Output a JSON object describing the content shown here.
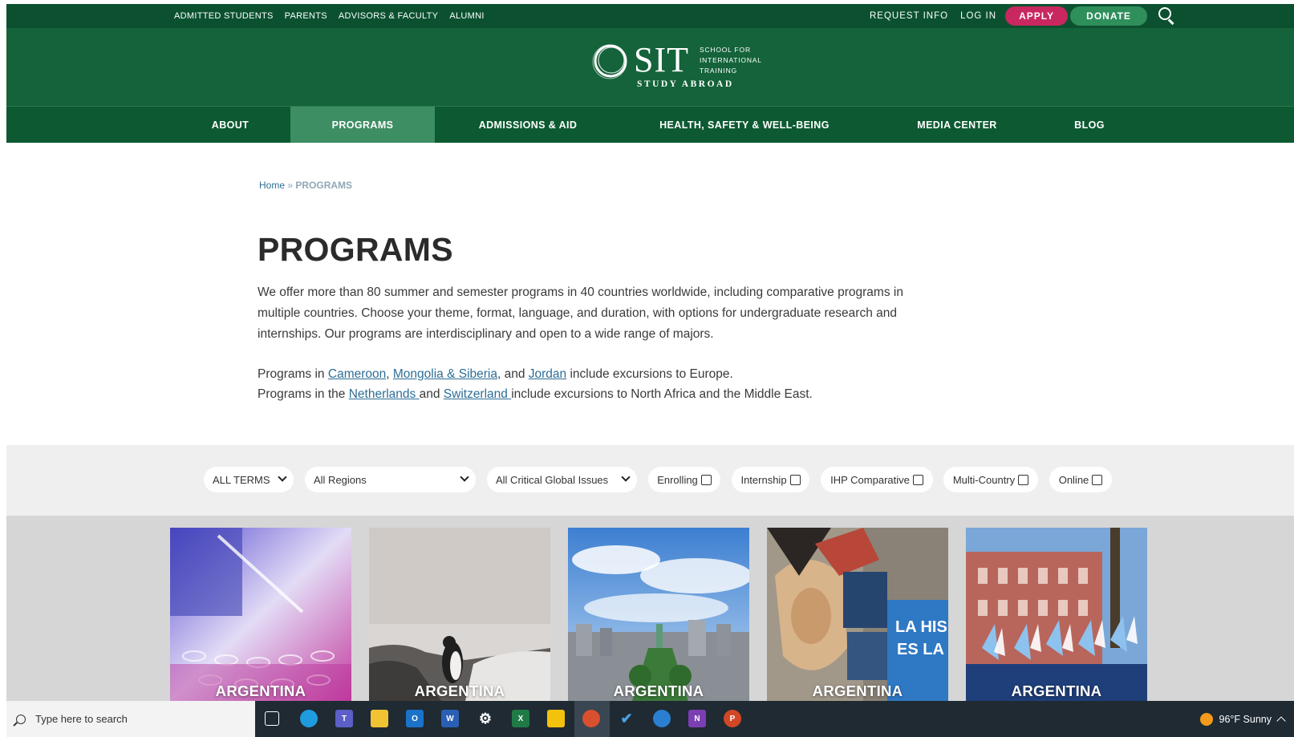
{
  "utility_nav": {
    "left_links": [
      "ADMITTED STUDENTS",
      "PARENTS",
      "ADVISORS & FACULTY",
      "ALUMNI"
    ],
    "request_info": "REQUEST INFO",
    "log_in": "LOG IN",
    "apply": "APPLY",
    "donate": "DONATE"
  },
  "logo": {
    "sit": "SIT",
    "school_line1": "SCHOOL FOR",
    "school_line2": "INTERNATIONAL",
    "school_line3": "TRAINING",
    "study_abroad": "STUDY ABROAD"
  },
  "main_nav": [
    "ABOUT",
    "PROGRAMS",
    "ADMISSIONS & AID",
    "HEALTH, SAFETY & WELL-BEING",
    "MEDIA CENTER",
    "BLOG"
  ],
  "breadcrumb": {
    "home": "Home",
    "sep": "»",
    "current": "PROGRAMS"
  },
  "page_title": "PROGRAMS",
  "intro": "We offer more than 80 summer and semester programs in 40 countries worldwide, including comparative programs in multiple countries. Choose your theme, format, language, and duration, with options for undergraduate research and internships. Our programs are interdisciplinary and open to a wide range of majors.",
  "excursions_europe": {
    "prefix": "Programs in ",
    "link1": "Cameroon",
    "comma": ", ",
    "link2": "Mongolia & Siberia",
    "and": ", and ",
    "link3": "Jordan",
    "suffix": " include excursions to Europe."
  },
  "excursions_africa": {
    "prefix": "Programs in the ",
    "link1": "Netherlands ",
    "and": "and ",
    "link2": "Switzerland ",
    "suffix": "include excursions to North Africa and the Middle East."
  },
  "filters": {
    "term": "ALL TERMS",
    "region": "All Regions",
    "issue": "All Critical Global Issues",
    "enrolling": "Enrolling",
    "internship": "Internship",
    "ihp": "IHP Comparative",
    "multi": "Multi-Country",
    "online": "Online"
  },
  "cards": [
    "ARGENTINA",
    "ARGENTINA",
    "ARGENTINA",
    "ARGENTINA",
    "ARGENTINA"
  ],
  "taskbar": {
    "search_placeholder": "Type here to search",
    "weather": "96°F  Sunny"
  }
}
